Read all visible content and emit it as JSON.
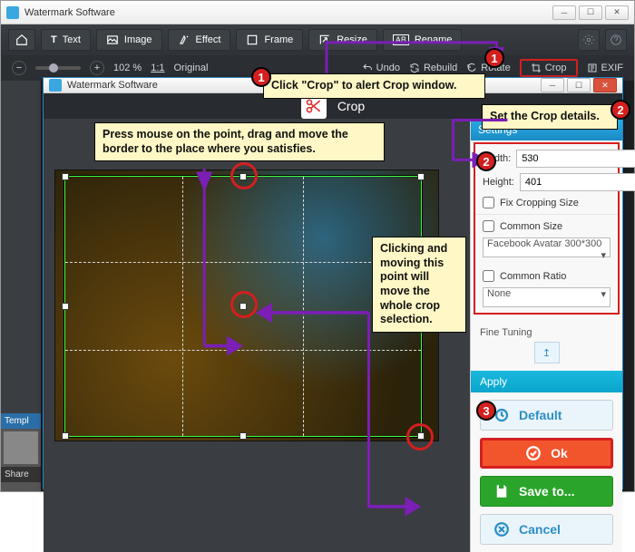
{
  "main": {
    "title": "Watermark Software",
    "toolbar": {
      "home": "⌂",
      "text": "Text",
      "image": "Image",
      "effect": "Effect",
      "frame": "Frame",
      "resize": "Resize",
      "rename": "Rename"
    },
    "subbar": {
      "zoom_pct": "102 %",
      "ratio": "1:1",
      "original": "Original",
      "undo": "Undo",
      "rebuild": "Rebuild",
      "rotate": "Rotate",
      "crop": "Crop",
      "exif": "EXIF"
    },
    "left": {
      "templates": "Templ",
      "share": "Share"
    }
  },
  "annotations": {
    "n1": "Click \"Crop\" to alert Crop window.",
    "n2": "Set the Crop details.",
    "n3": "Press mouse on the point, drag and move the border to the place where you satisfies.",
    "n4": "Clicking and moving this point will move the whole crop selection."
  },
  "crop": {
    "title": "Watermark Software",
    "banner": "Crop",
    "settings_hdr": "Settings",
    "width_label": "Width:",
    "width_value": "530",
    "height_label": "Height:",
    "height_value": "401",
    "fix_size": "Fix Cropping Size",
    "common_size": "Common Size",
    "common_size_sel": "Facebook Avatar 300*300",
    "common_ratio": "Common Ratio",
    "common_ratio_sel": "None",
    "fine_tune": "Fine Tuning",
    "apply_hdr": "Apply",
    "btn_default": "Default",
    "btn_ok": "Ok",
    "btn_save": "Save to...",
    "btn_cancel": "Cancel"
  }
}
